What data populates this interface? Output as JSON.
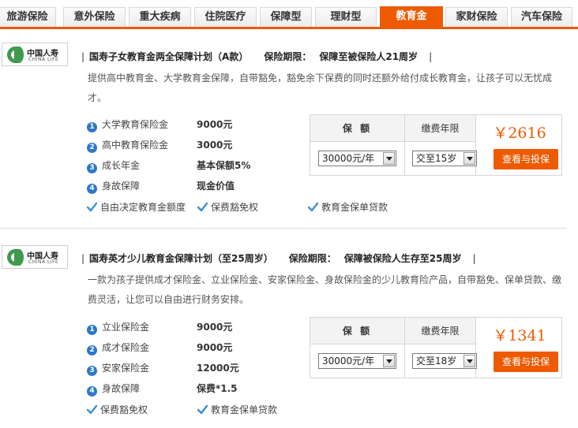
{
  "tabs": [
    {
      "label": "旅游保险",
      "active": false
    },
    {
      "label": "意外保险",
      "active": false
    },
    {
      "label": "重大疾病",
      "active": false
    },
    {
      "label": "住院医疗",
      "active": false
    },
    {
      "label": "保障型",
      "active": false
    },
    {
      "label": "理财型",
      "active": false
    },
    {
      "label": "教育金",
      "active": true
    },
    {
      "label": "家财保险",
      "active": false
    },
    {
      "label": "汽车保险",
      "active": false
    }
  ],
  "colors": {
    "accent": "#ee5a00",
    "number_badge": "#2d78c8",
    "check": "#3c8fd1",
    "logo_green": "#3f9a4f"
  },
  "products": [
    {
      "logo": {
        "name": "中国人寿",
        "en": "CHINA LIFE"
      },
      "title": "国寿子女教育金两全保障计划（A款）",
      "period_label": "保险期限：",
      "period_value": "保障至被保险人21周岁",
      "description": "提供高中教育金、大学教育金保障，自带豁免，豁免余下保费的同时还额外给付成长教育金，让孩子可以无忧成才。",
      "features": [
        {
          "no": "1",
          "name": "大学教育保险金",
          "value": "9000元"
        },
        {
          "no": "2",
          "name": "高中教育保险金",
          "value": "3000元"
        },
        {
          "no": "3",
          "name": "成长年金",
          "value": "基本保额5%"
        },
        {
          "no": "4",
          "name": "身故保障",
          "value": "现金价值"
        }
      ],
      "checks": [
        "自由决定教育金额度",
        "保费豁免权",
        "教育金保单贷款"
      ],
      "pricing": {
        "amount_header": "保 额",
        "years_header": "缴费年限",
        "amount_selected": "30000元/年",
        "years_selected": "交至15岁",
        "price": "￥2616",
        "buy_label": "查看与投保"
      }
    },
    {
      "logo": {
        "name": "中国人寿",
        "en": "CHINA LIFE"
      },
      "title": "国寿英才少儿教育金保障计划（至25周岁）",
      "period_label": "保险期限：",
      "period_value": "保障被保险人生存至25周岁",
      "description": "一款为孩子提供成才保险金、立业保险金、安家保险金、身故保险金的少儿教育险产品，自带豁免、保单贷款、缴费灵活，让您可以自由进行财务安排。",
      "features": [
        {
          "no": "1",
          "name": "立业保险金",
          "value": "9000元"
        },
        {
          "no": "2",
          "name": "成才保险金",
          "value": "9000元"
        },
        {
          "no": "3",
          "name": "安家保险金",
          "value": "12000元"
        },
        {
          "no": "4",
          "name": "身故保障",
          "value": "保费*1.5"
        }
      ],
      "checks": [
        "保费豁免权",
        "教育金保单贷款"
      ],
      "pricing": {
        "amount_header": "保 额",
        "years_header": "缴费年限",
        "amount_selected": "30000元/年",
        "years_selected": "交至18岁",
        "price": "￥1341",
        "buy_label": "查看与投保"
      }
    }
  ]
}
